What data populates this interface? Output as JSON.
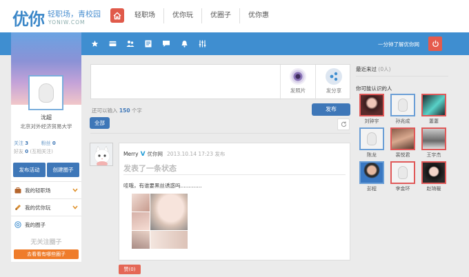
{
  "header": {
    "logo_text": "优你",
    "slogan": "轻职场，青校园",
    "url_text": "YONIW.COM",
    "nav": [
      "轻职场",
      "优你玩",
      "优圈子",
      "优你惠"
    ]
  },
  "toolbar": {
    "promo_link": "一分钟了解优你网",
    "icons": [
      "star-icon",
      "card-icon",
      "people-icon",
      "document-icon",
      "chat-icon",
      "bell-icon",
      "sliders-icon",
      "power-icon"
    ]
  },
  "profile": {
    "name": "沈超",
    "school": "北京对外经济贸易大学",
    "follow_label": "关注",
    "follow_count": "3",
    "fans_label": "粉丝",
    "fans_count": "0",
    "friends_label": "好友",
    "friends_count": "0",
    "friends_note": "(互相关注)",
    "btn_post_activity": "发布活动",
    "btn_create_circle": "创建圈子",
    "menu": [
      {
        "label": "我的轻职场"
      },
      {
        "label": "我的优你玩"
      },
      {
        "label": "我的圈子"
      }
    ],
    "no_follow_text": "无关注圈子",
    "explore_btn": "去看看有哪些圈子"
  },
  "composer": {
    "photo_label": "发照片",
    "share_label": "发分享",
    "char_hint_pre": "还可以输入",
    "char_count": "150",
    "char_hint_post": "个字",
    "publish_label": "发布",
    "filter_all": "全部"
  },
  "post": {
    "author": "Merry",
    "verified": "V",
    "source": "优你网",
    "time": "2013.10.14 17:23 发布",
    "title": "发表了一条状态",
    "text": "哇哦，有谁要黑丝诱惑吗.............",
    "like_label": "赞(0)"
  },
  "right": {
    "recent_title": "最近来过",
    "recent_count": "(0人)",
    "suggest_title": "你可能认识的人",
    "friends": [
      {
        "name": "刘钟宇",
        "frame": "red"
      },
      {
        "name": "孙兆成",
        "frame": "blue"
      },
      {
        "name": "萋萋",
        "frame": "red"
      },
      {
        "name": "陈龙",
        "frame": "blue"
      },
      {
        "name": "裴悦君",
        "frame": "red"
      },
      {
        "name": "王宇杰",
        "frame": "red"
      },
      {
        "name": "彭程",
        "frame": "blue"
      },
      {
        "name": "李金环",
        "frame": "red"
      },
      {
        "name": "赵琦暖",
        "frame": "red"
      }
    ]
  },
  "colors": {
    "brand_blue": "#3f8ed0",
    "button_blue": "#3e77b8",
    "accent_red": "#e05a4a",
    "orange": "#ef7c2a"
  }
}
